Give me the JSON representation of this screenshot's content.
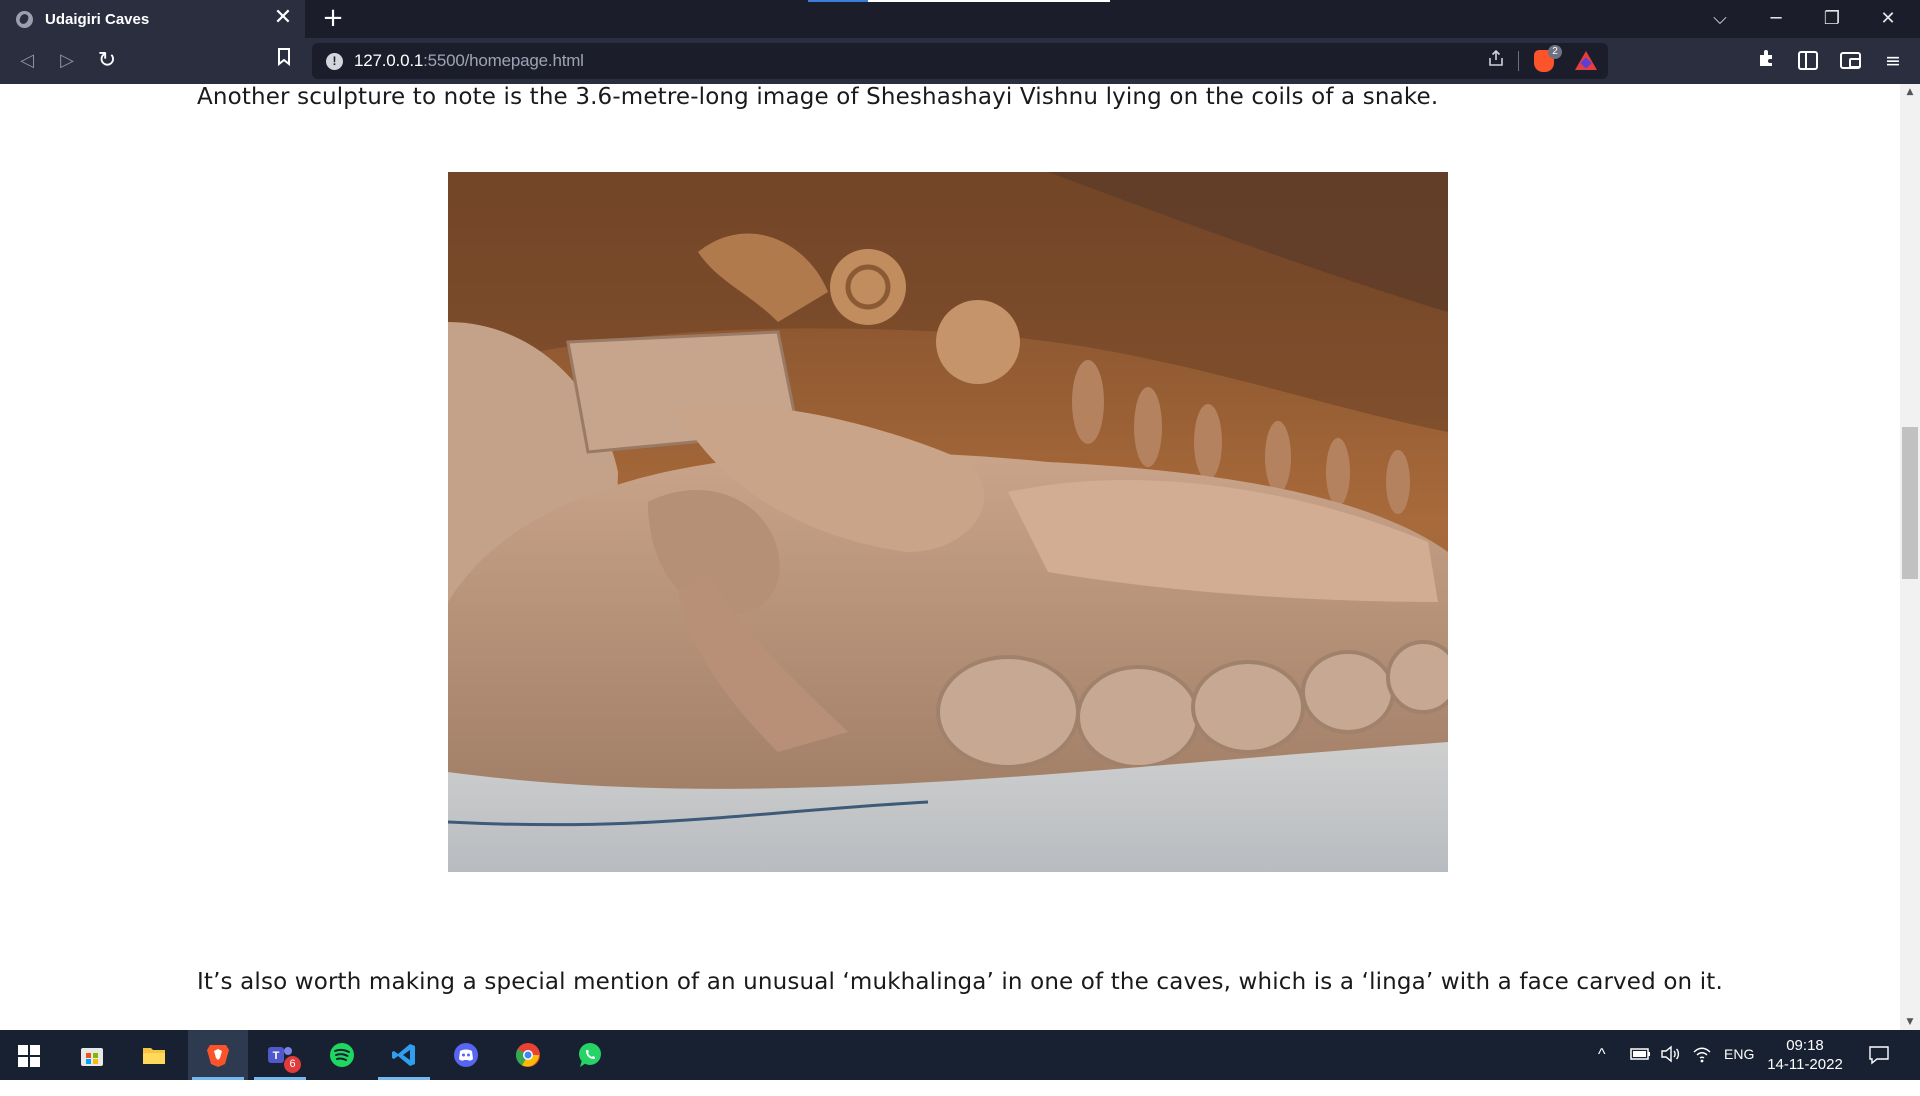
{
  "browser": {
    "tab": {
      "title": "Udaigiri Caves",
      "close": "✕"
    },
    "new_tab": "+",
    "window_controls": {
      "collapse": "⌵",
      "minimize": "─",
      "restore": "❐",
      "close": "✕"
    },
    "toolbar": {
      "back": "◁",
      "forward": "▷",
      "reload": "↻",
      "bookmark": "🔖",
      "share": "⇪",
      "shields_count": "2",
      "extensions": "✚",
      "menu": "≡"
    },
    "url": {
      "host": "127.0.0.1",
      "rest": ":5500/homepage.html"
    }
  },
  "page": {
    "paragraph_1": "Another sculpture to note is the 3.6-metre-long image of Sheshashayi Vishnu lying on the coils of a snake.",
    "paragraph_2": "It’s also worth making a special mention of an unusual ‘mukhalinga’ in one of the caves, which is a ‘linga’ with a face carved on it.",
    "image_subject": "reclining Vishnu rock-cut sculpture"
  },
  "scrollbar": {
    "up": "▲",
    "down": "▼"
  },
  "taskbar": {
    "apps": [
      "windows-start",
      "microsoft-store",
      "file-explorer",
      "brave-browser",
      "microsoft-teams",
      "spotify",
      "visual-studio-code",
      "discord",
      "google-chrome-dev",
      "whatsapp"
    ],
    "teams_badge": "6",
    "tray": {
      "chevron": "^",
      "battery": "▭",
      "volume": "🕪",
      "wifi": "◠",
      "language": "ENG",
      "notifications": "▭"
    },
    "clock": {
      "time": "09:18",
      "date": "14-11-2022"
    }
  },
  "colors": {
    "tab_strip": "#1b1d2b",
    "toolbar": "#2b2e3f",
    "taskbar": "#182131",
    "brave_orange": "#fb542b"
  }
}
